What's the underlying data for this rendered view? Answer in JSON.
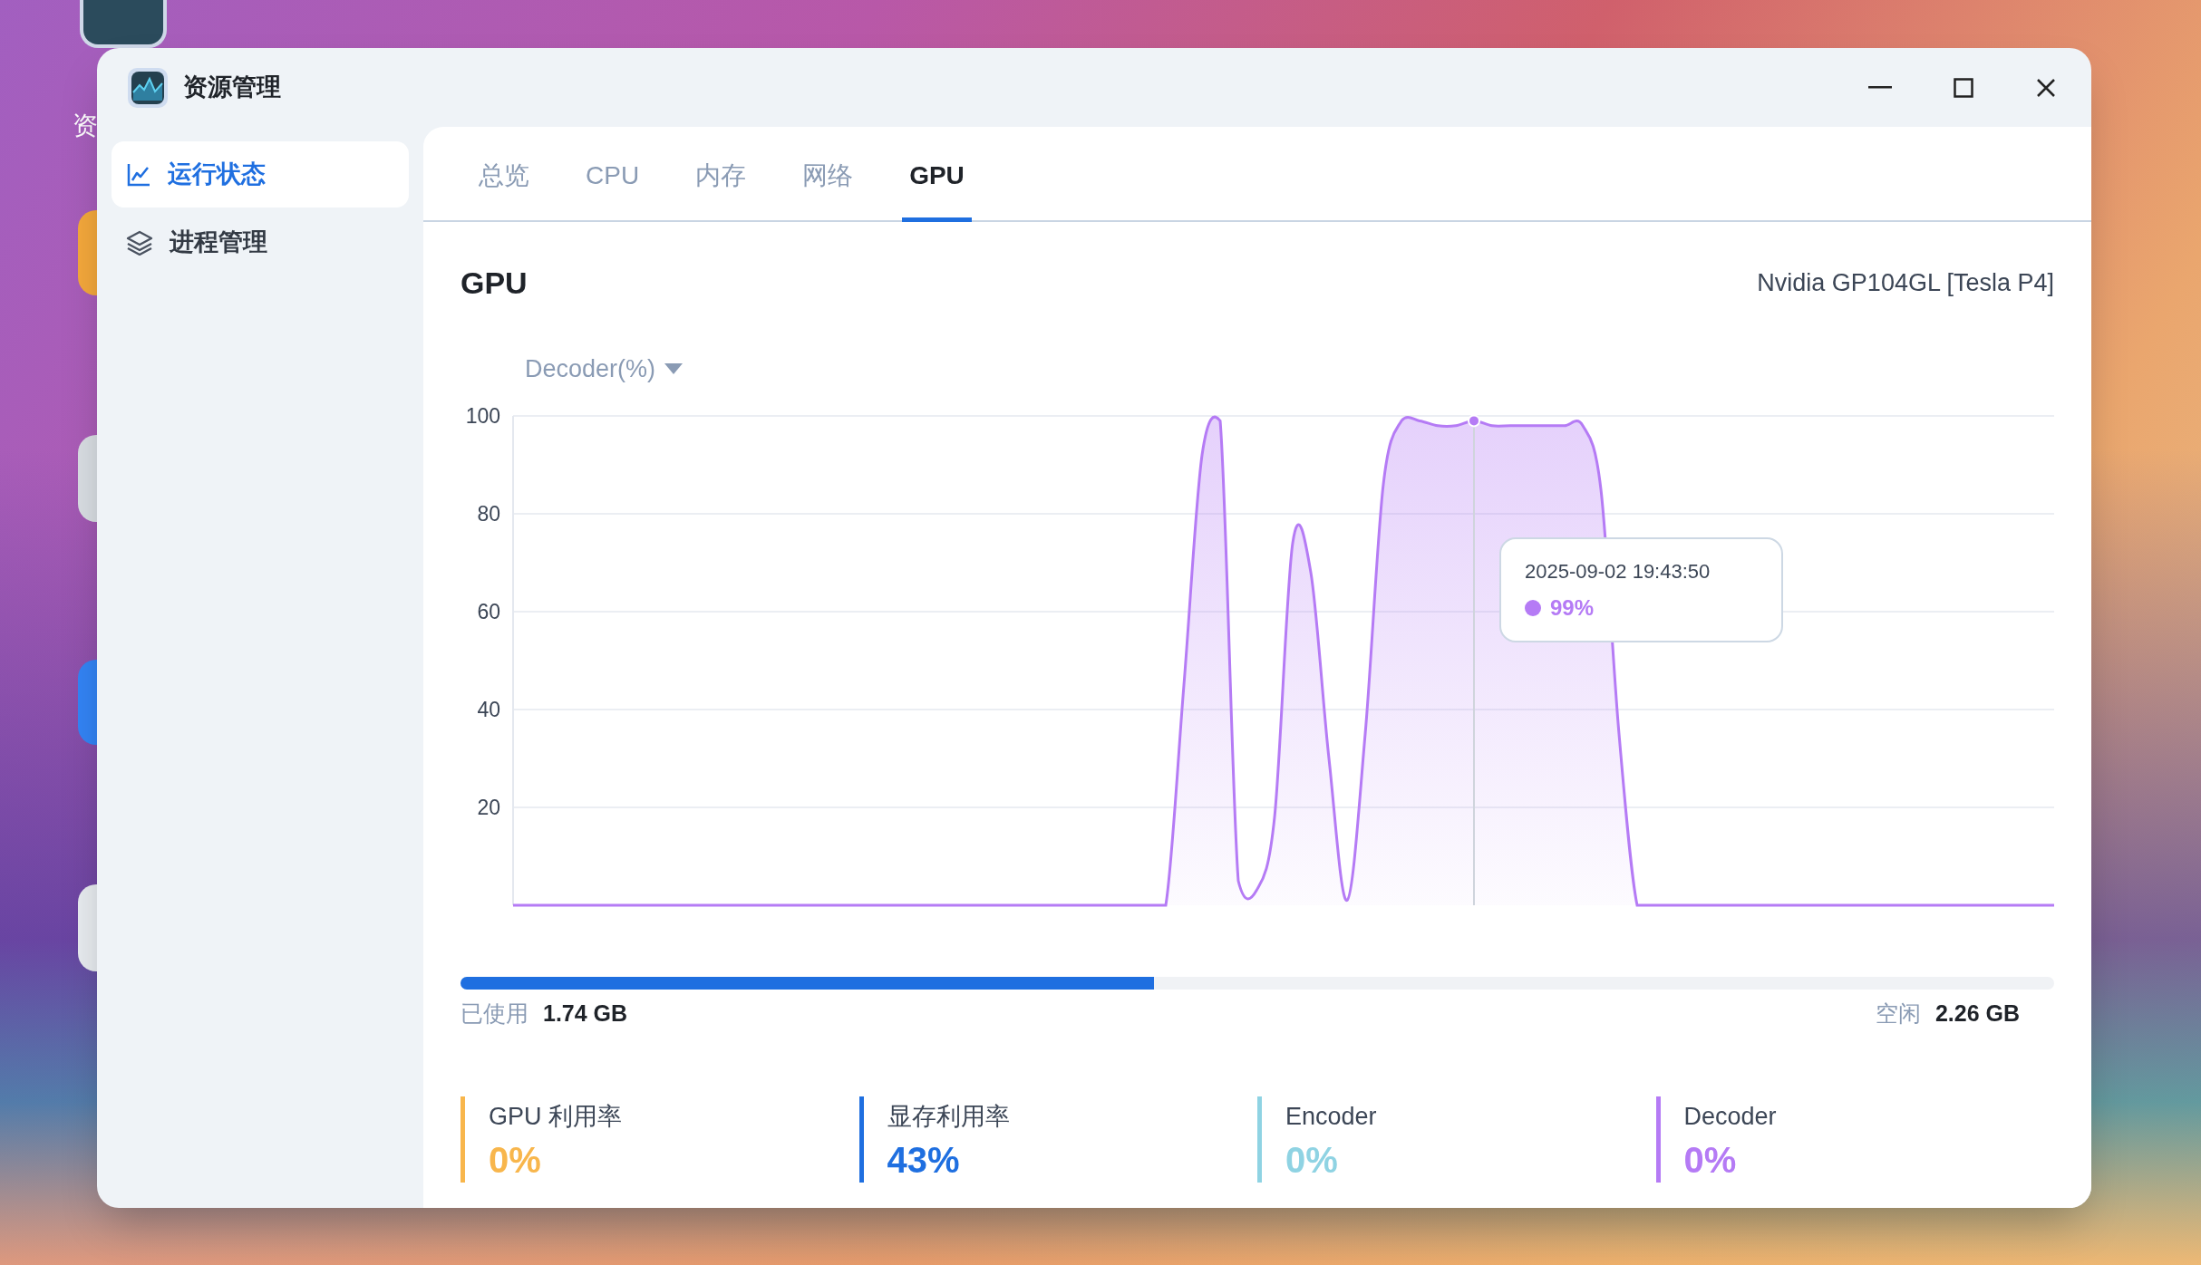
{
  "desktop": {
    "icon_label": "资"
  },
  "window": {
    "title": "资源管理"
  },
  "sidebar": {
    "items": [
      {
        "label": "运行状态",
        "selected": true
      },
      {
        "label": "进程管理",
        "selected": false
      }
    ]
  },
  "tabs": [
    {
      "label": "总览",
      "selected": false
    },
    {
      "label": "CPU",
      "selected": false
    },
    {
      "label": "内存",
      "selected": false
    },
    {
      "label": "网络",
      "selected": false
    },
    {
      "label": "GPU",
      "selected": true
    }
  ],
  "gpu": {
    "title": "GPU",
    "model": "Nvidia GP104GL [Tesla P4]",
    "chart_data": {
      "type": "area",
      "ylim": [
        0,
        100
      ],
      "yticks": [
        20,
        40,
        60,
        80,
        100
      ],
      "series": [
        {
          "name": "Decoder(%)",
          "color": "#b57bf5",
          "values": [
            0,
            0,
            0,
            0,
            0,
            0,
            0,
            0,
            0,
            0,
            0,
            0,
            0,
            0,
            0,
            0,
            0,
            0,
            0,
            0,
            0,
            0,
            0,
            0,
            0,
            0,
            0,
            0,
            0,
            0,
            0,
            0,
            0,
            0,
            0,
            0,
            0,
            45,
            92,
            99,
            5,
            3,
            18,
            74,
            68,
            30,
            1,
            35,
            86,
            99,
            99,
            98,
            98,
            99,
            98,
            98,
            98,
            98,
            98,
            98,
            85,
            35,
            0,
            0,
            0,
            0,
            0,
            0,
            0,
            0,
            0,
            0,
            0,
            0,
            0,
            0,
            0,
            0,
            0,
            0,
            0,
            0,
            0,
            0,
            0,
            0
          ]
        }
      ],
      "grid": true
    },
    "tooltip": {
      "time": "2025-09-02 19:43:50",
      "value": "99%"
    },
    "memory": {
      "level": 0.435,
      "used_label": "已使用",
      "used": "1.74 GB",
      "free_label": "空闲",
      "free": "2.26 GB"
    },
    "stats": [
      {
        "label": "GPU 利用率",
        "value": "0%",
        "color": "#f8b64c"
      },
      {
        "label": "显存利用率",
        "value": "43%",
        "color": "#1f6fe0"
      },
      {
        "label": "Encoder",
        "value": "0%",
        "color": "#8fd3e3"
      },
      {
        "label": "Decoder",
        "value": "0%",
        "color": "#b57bf5"
      }
    ]
  }
}
